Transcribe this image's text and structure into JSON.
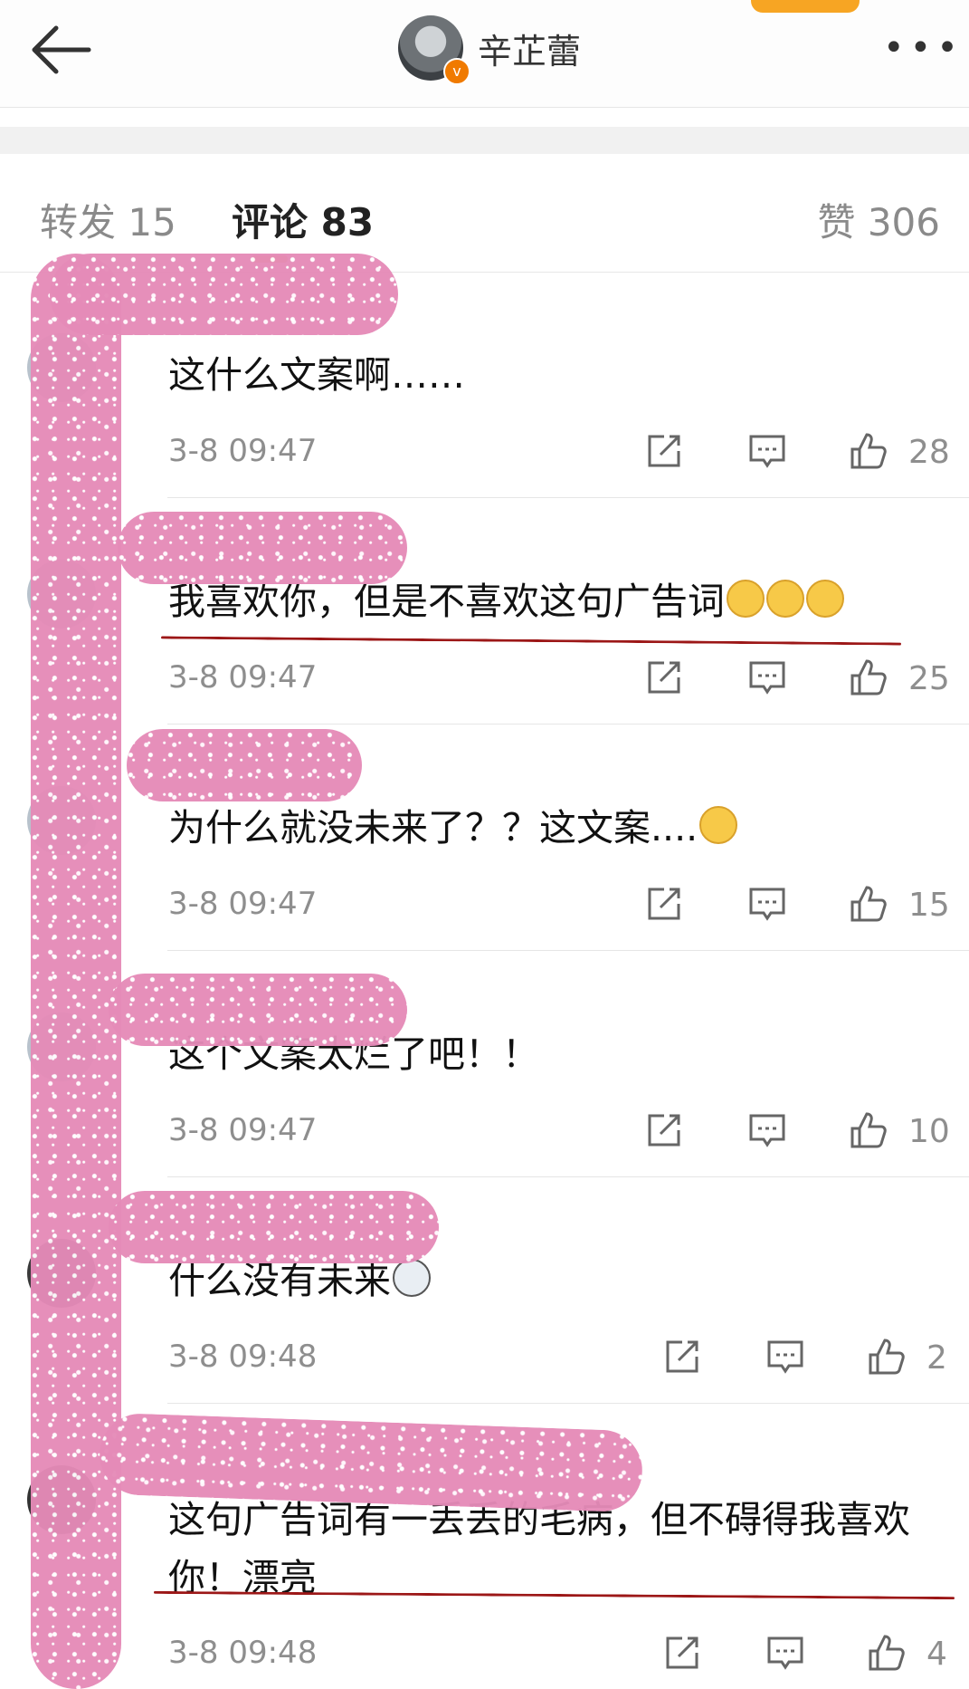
{
  "header": {
    "username": "辛芷蕾",
    "verified_badge": "v",
    "more_label": "•••"
  },
  "tabs": {
    "repost": "转发 15",
    "comments": "评论 83",
    "likes": "赞 306"
  },
  "comments": [
    {
      "text": "这什么文案啊……",
      "time": "3-8 09:47",
      "likes": "28"
    },
    {
      "text": "我喜欢你，但是不喜欢这句广告词",
      "emoji": [
        "sweat-face",
        "sweat-face",
        "sweat-face"
      ],
      "time": "3-8 09:47",
      "likes": "25"
    },
    {
      "text": "为什么就没未来了？？这文案....",
      "emoji": [
        "confused-face"
      ],
      "time": "3-8 09:47",
      "likes": "15"
    },
    {
      "text": "这个文案太烂了吧！！",
      "time": "3-8 09:47",
      "likes": "10"
    },
    {
      "text": "什么没有未来",
      "emoji": [
        "husky-face"
      ],
      "time": "3-8 09:48",
      "likes": "2"
    },
    {
      "text": "这句广告词有一丢丢的毛病，但不碍得我喜欢你！漂亮",
      "time": "3-8 09:48",
      "likes": "4"
    }
  ],
  "colors": {
    "accent": "#f7a523",
    "underline": "#9c1717",
    "glitter": "#e58bb8"
  }
}
